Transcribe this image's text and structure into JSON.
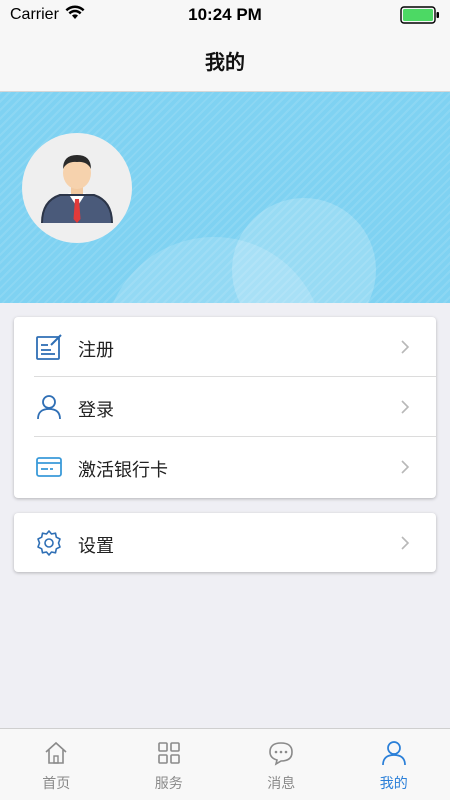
{
  "status_bar": {
    "carrier": "Carrier",
    "time": "10:24 PM"
  },
  "nav": {
    "title": "我的"
  },
  "profile": {
    "avatar_icon": "businessman-avatar-icon"
  },
  "menu": {
    "group1": [
      {
        "label": "注册",
        "icon": "register-edit-icon"
      },
      {
        "label": "登录",
        "icon": "user-icon"
      },
      {
        "label": "激活银行卡",
        "icon": "bank-card-icon"
      }
    ],
    "group2": [
      {
        "label": "设置",
        "icon": "gear-icon"
      }
    ]
  },
  "tabs": [
    {
      "label": "首页",
      "icon": "home-icon",
      "active": false
    },
    {
      "label": "服务",
      "icon": "grid-icon",
      "active": false
    },
    {
      "label": "消息",
      "icon": "message-icon",
      "active": false
    },
    {
      "label": "我的",
      "icon": "user-icon",
      "active": true
    }
  ],
  "colors": {
    "banner": "#7fd2f2",
    "accent": "#2a7fd8",
    "icon_blue": "#2f6fb5",
    "battery": "#4cd964"
  }
}
